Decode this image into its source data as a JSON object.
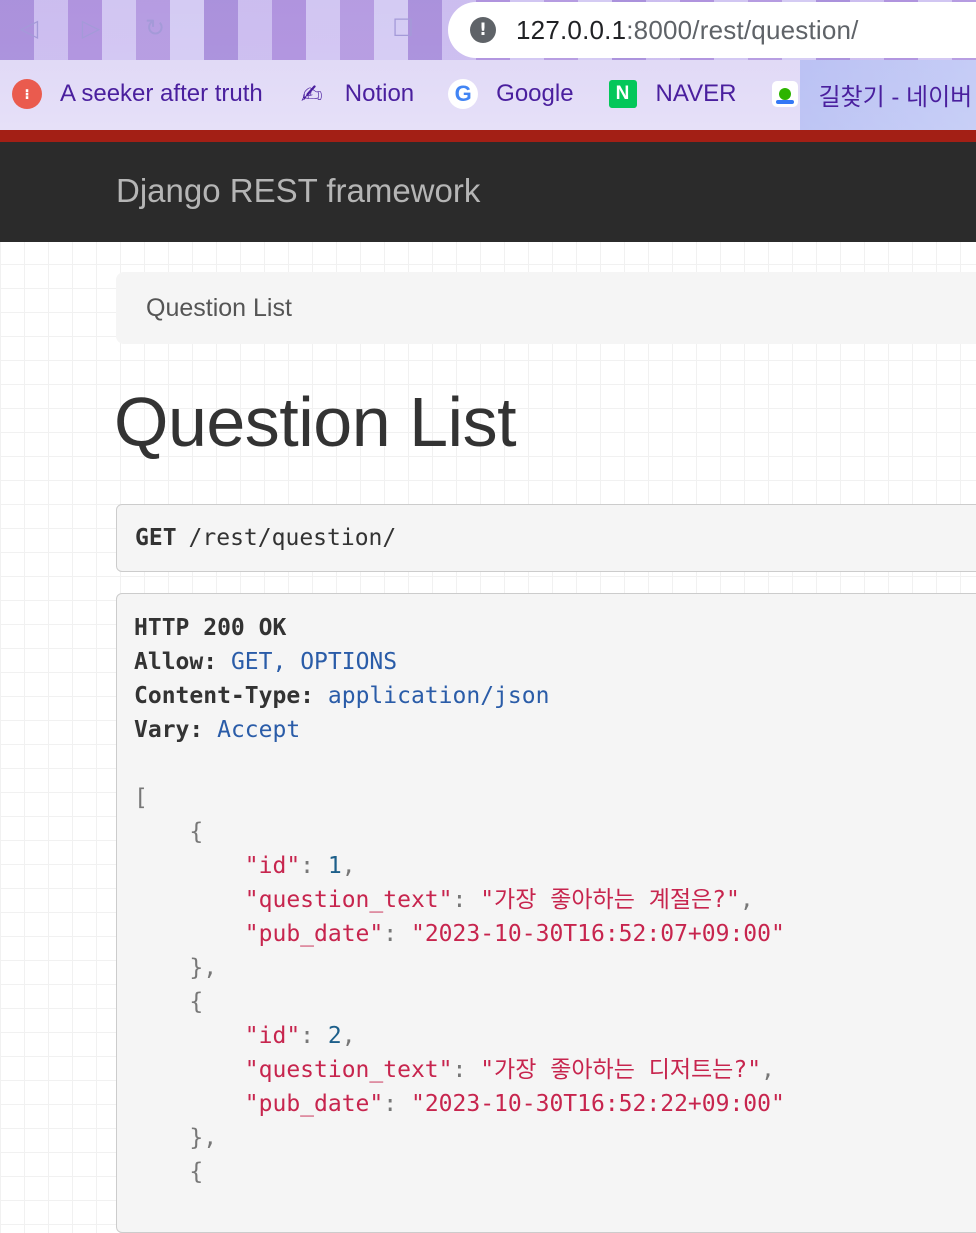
{
  "browser": {
    "url_host": "127.0.0.1",
    "url_rest": ":8000/rest/question/",
    "bookmarks": [
      {
        "label": "A seeker after truth",
        "icon": "seeker-favicon"
      },
      {
        "label": "Notion",
        "icon": "writing-hand-icon"
      },
      {
        "label": "Google",
        "icon": "google-icon"
      },
      {
        "label": "NAVER",
        "icon": "naver-icon"
      },
      {
        "label": "길찾기 - 네이버",
        "icon": "map-icon"
      }
    ]
  },
  "navbar": {
    "brand": "Django REST framework"
  },
  "breadcrumb": {
    "current": "Question List"
  },
  "page": {
    "title": "Question List"
  },
  "request": {
    "method": "GET",
    "path": "/rest/question/"
  },
  "response": {
    "status": "HTTP 200 OK",
    "headers": [
      {
        "name": "Allow:",
        "value": "GET, OPTIONS"
      },
      {
        "name": "Content-Type:",
        "value": "application/json"
      },
      {
        "name": "Vary:",
        "value": "Accept"
      }
    ],
    "items": [
      {
        "id": "1",
        "question_text": "\"가장 좋아하는 계절은?\"",
        "pub_date": "\"2023-10-30T16:52:07+09:00\""
      },
      {
        "id": "2",
        "question_text": "\"가장 좋아하는 디저트는?\"",
        "pub_date": "\"2023-10-30T16:52:22+09:00\""
      }
    ],
    "keys": {
      "id": "\"id\"",
      "question_text": "\"question_text\"",
      "pub_date": "\"pub_date\""
    }
  },
  "colors": {
    "navbar": "#2b2b2b",
    "accent": "#a31f15",
    "json_key": "#c7254e",
    "json_number": "#1d5f8a"
  }
}
